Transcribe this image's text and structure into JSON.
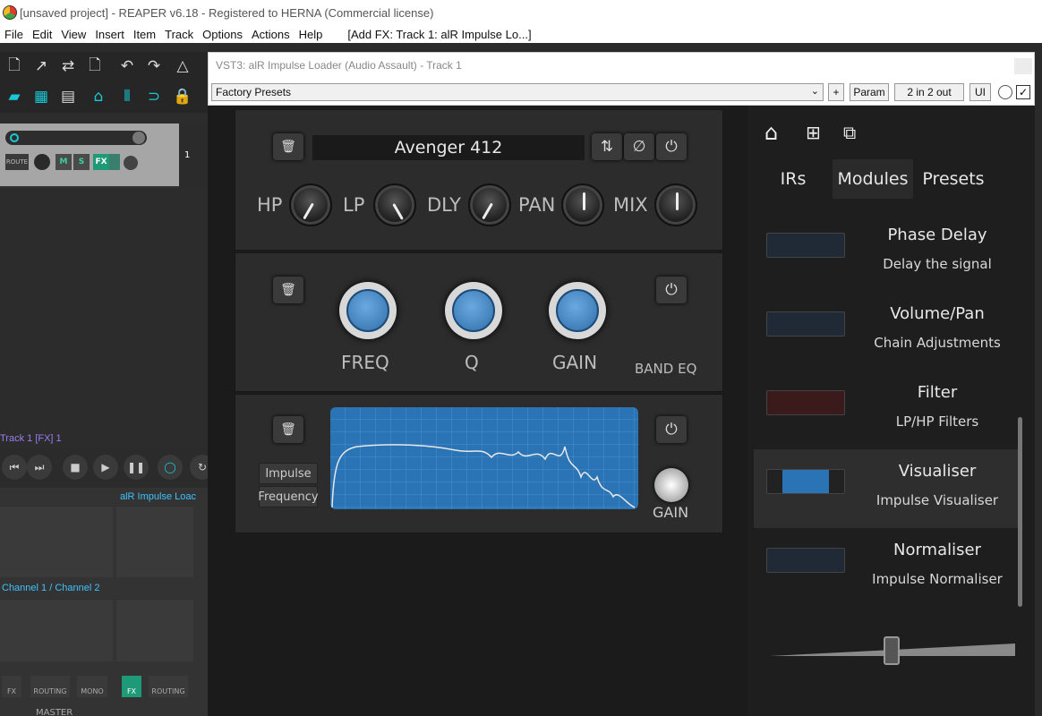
{
  "window": {
    "title": "[unsaved project] - REAPER v6.18 - Registered to HERNA (Commercial license)"
  },
  "menu": {
    "items": [
      "File",
      "Edit",
      "View",
      "Insert",
      "Item",
      "Track",
      "Options",
      "Actions",
      "Help"
    ],
    "add_fx": "[Add FX: Track 1: alR Impulse Lo...]"
  },
  "track": {
    "route": "ROUTE",
    "m": "M",
    "s": "S",
    "fx": "FX",
    "number": "1"
  },
  "transport": {
    "title": "Track 1 [FX] 1"
  },
  "mixer": {
    "plugin_name": "alR Impulse Loac",
    "channel": "Channel 1 / Channel 2",
    "fx": "FX",
    "routing": "ROUTING",
    "mono": "MONO",
    "master": "MASTER",
    "routing2": "ROUTING",
    "fx2": "FX"
  },
  "vst": {
    "title": "VST3: alR Impulse Loader (Audio Assault) - Track 1",
    "preset": "Factory Presets",
    "plus": "+",
    "param": "Param",
    "io": "2 in 2 out",
    "ui": "UI"
  },
  "ir_module": {
    "name": "Avenger 412",
    "knobs": [
      "HP",
      "LP",
      "DLY",
      "PAN",
      "MIX"
    ]
  },
  "eq_module": {
    "knobs": [
      "FREQ",
      "Q",
      "GAIN"
    ],
    "label": "BAND EQ"
  },
  "vis_module": {
    "btn_impulse": "Impulse",
    "btn_frequency": "Frequency",
    "gain": "GAIN"
  },
  "side": {
    "tabs": [
      "IRs",
      "Modules",
      "Presets"
    ],
    "active_tab": "Modules",
    "modules": [
      {
        "name": "Phase Delay",
        "desc": "Delay the signal"
      },
      {
        "name": "Volume/Pan",
        "desc": "Chain Adjustments"
      },
      {
        "name": "Filter",
        "desc": "LP/HP Filters"
      },
      {
        "name": "Visualiser",
        "desc": "Impulse Visualiser"
      },
      {
        "name": "Normaliser",
        "desc": "Impulse Normaliser"
      }
    ],
    "selected_index": 3
  },
  "colors": {
    "accent": "#19c9d6",
    "knob_blue": "#3f8ccc",
    "graph": "#2a73b5",
    "track_title": "#9a7cf0"
  }
}
